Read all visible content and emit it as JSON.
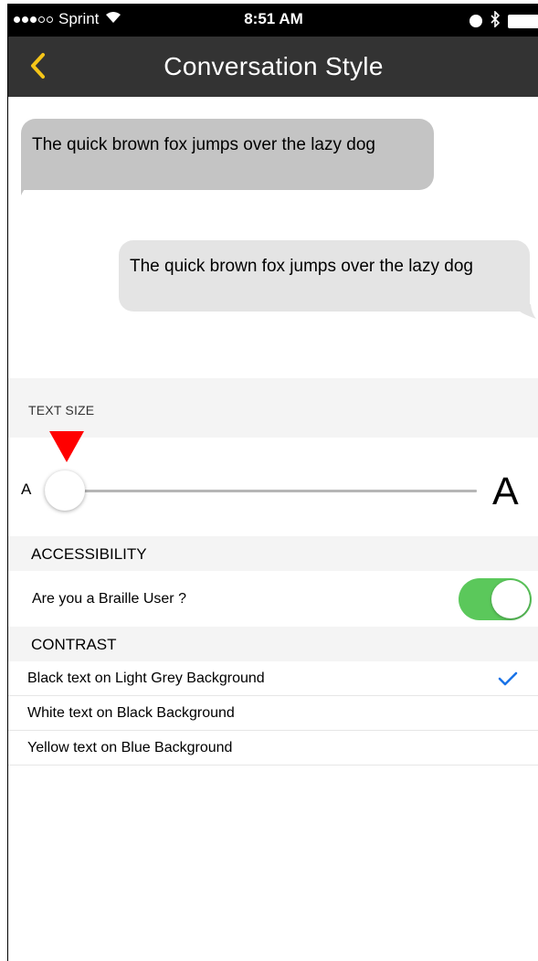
{
  "status_bar": {
    "carrier": "Sprint",
    "time": "8:51 AM"
  },
  "nav": {
    "title": "Conversation Style",
    "back_icon": "chevron-left-icon",
    "accent_color": "#f5c518"
  },
  "messages": [
    {
      "direction": "incoming",
      "text": "The quick brown fox jumps over the lazy dog"
    },
    {
      "direction": "outgoing",
      "text": "The quick brown fox jumps over the lazy dog"
    }
  ],
  "text_size": {
    "header": "TEXT SIZE",
    "small_label": "A",
    "large_label": "A",
    "slider_value": 0
  },
  "accessibility": {
    "header": "ACCESSIBILITY",
    "braille_label": "Are you a Braille User ?",
    "braille_on": true,
    "toggle_color": "#5bc85b"
  },
  "contrast": {
    "header": "CONTRAST",
    "options": [
      {
        "label": "Black text on Light Grey Background",
        "selected": true
      },
      {
        "label": "White text on Black Background",
        "selected": false
      },
      {
        "label": "Yellow text on Blue Background",
        "selected": false
      }
    ],
    "check_color": "#1a73e8"
  }
}
